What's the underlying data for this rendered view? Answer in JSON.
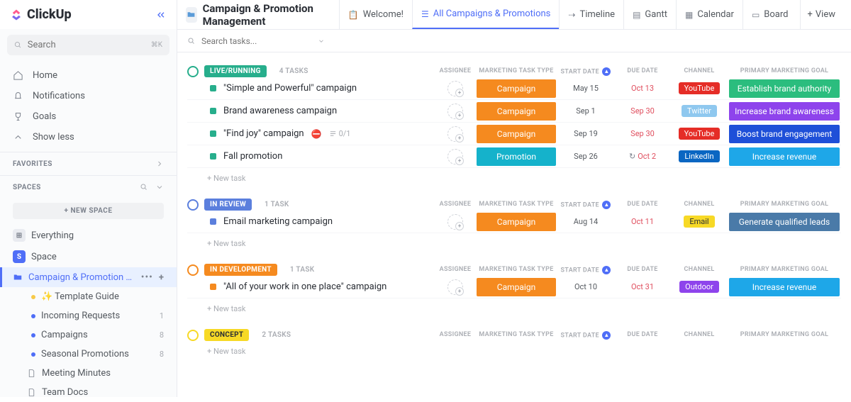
{
  "brand": "ClickUp",
  "sidebar": {
    "search_placeholder": "Search",
    "kbd": "⌘K",
    "nav": [
      {
        "label": "Home"
      },
      {
        "label": "Notifications"
      },
      {
        "label": "Goals"
      },
      {
        "label": "Show less"
      }
    ],
    "favorites_label": "FAVORITES",
    "spaces_label": "SPACES",
    "new_space": "+  NEW SPACE",
    "everything": "Everything",
    "space": {
      "letter": "S",
      "name": "Space",
      "color": "#4f6ef7"
    },
    "folder": {
      "name": "Campaign & Promotion M...",
      "items": [
        {
          "label": "✨ Template Guide",
          "dot": "#f7c948",
          "count": ""
        },
        {
          "label": "Incoming Requests",
          "dot": "#4f6ef7",
          "count": "1"
        },
        {
          "label": "Campaigns",
          "dot": "#4f6ef7",
          "count": "8"
        },
        {
          "label": "Seasonal Promotions",
          "dot": "#4f6ef7",
          "count": "8"
        }
      ]
    },
    "docs": [
      {
        "label": "Meeting Minutes"
      },
      {
        "label": "Team Docs"
      }
    ]
  },
  "header": {
    "title": "Campaign & Promotion Management",
    "tabs": [
      {
        "label": "Welcome!"
      },
      {
        "label": "All Campaigns & Promotions",
        "active": true
      },
      {
        "label": "Timeline"
      },
      {
        "label": "Gantt"
      },
      {
        "label": "Calendar"
      },
      {
        "label": "Board"
      }
    ],
    "view": "View"
  },
  "filter": {
    "search_placeholder": "Search tasks..."
  },
  "columns": {
    "assignee": "ASSIGNEE",
    "type": "MARKETING TASK TYPE",
    "start": "START DATE",
    "due": "DUE DATE",
    "channel": "CHANNEL",
    "goal": "PRIMARY MARKETING GOAL"
  },
  "groups": [
    {
      "status": "LIVE/RUNNING",
      "status_bg": "#27ae8c",
      "ring": "#27ae8c",
      "count": "4 TASKS",
      "tasks": [
        {
          "sq": "#27ae8c",
          "title": "\"Simple and Powerful\" campaign",
          "type": "Campaign",
          "type_bg": "#f58a1f",
          "start": "May 15",
          "due": "Oct 13",
          "due_recur": false,
          "channel": "YouTube",
          "channel_bg": "#e52d27",
          "goal": "Establish brand authority",
          "goal_bg": "#2bbd7e"
        },
        {
          "sq": "#27ae8c",
          "title": "Brand awareness campaign",
          "type": "Campaign",
          "type_bg": "#f58a1f",
          "start": "Sep 1",
          "due": "Sep 30",
          "due_recur": false,
          "channel": "Twitter",
          "channel_bg": "#8fc8ef",
          "goal": "Increase brand awareness",
          "goal_bg": "#8e44ec"
        },
        {
          "sq": "#27ae8c",
          "title": "\"Find joy\" campaign",
          "blocked": true,
          "sub": "0/1",
          "type": "Campaign",
          "type_bg": "#f58a1f",
          "start": "Sep 19",
          "due": "Sep 30",
          "due_recur": false,
          "channel": "YouTube",
          "channel_bg": "#e52d27",
          "goal": "Boost brand engagement",
          "goal_bg": "#1e4fd8"
        },
        {
          "sq": "#27ae8c",
          "title": "Fall promotion",
          "type": "Promotion",
          "type_bg": "#15b2cb",
          "start": "Sep 26",
          "due": "Oct 2",
          "due_recur": true,
          "channel": "LinkedIn",
          "channel_bg": "#0a66c2",
          "goal": "Increase revenue",
          "goal_bg": "#1ea7e8"
        }
      ]
    },
    {
      "status": "IN REVIEW",
      "status_bg": "#5b7fdd",
      "ring": "#5b7fdd",
      "count": "1 TASK",
      "tasks": [
        {
          "sq": "#5b7fdd",
          "title": "Email marketing campaign",
          "type": "Campaign",
          "type_bg": "#f58a1f",
          "start": "Aug 14",
          "due": "Oct 11",
          "channel": "Email",
          "channel_bg": "#f7d926",
          "channel_fg": "#292d34",
          "goal": "Generate qualified leads",
          "goal_bg": "#4a7aa8"
        }
      ]
    },
    {
      "status": "IN DEVELOPMENT",
      "status_bg": "#f58a1f",
      "ring": "#f58a1f",
      "count": "1 TASK",
      "tasks": [
        {
          "sq": "#f58a1f",
          "title": "\"All of your work in one place\" campaign",
          "type": "Campaign",
          "type_bg": "#f58a1f",
          "start": "Oct 10",
          "due": "Oct 31",
          "channel": "Outdoor",
          "channel_bg": "#8e44ec",
          "goal": "Increase revenue",
          "goal_bg": "#1ea7e8"
        }
      ]
    },
    {
      "status": "CONCEPT",
      "status_bg": "#f7d926",
      "status_fg": "#292d34",
      "ring": "#f7d926",
      "count": "2 TASKS",
      "tasks": []
    }
  ],
  "new_task": "+ New task"
}
